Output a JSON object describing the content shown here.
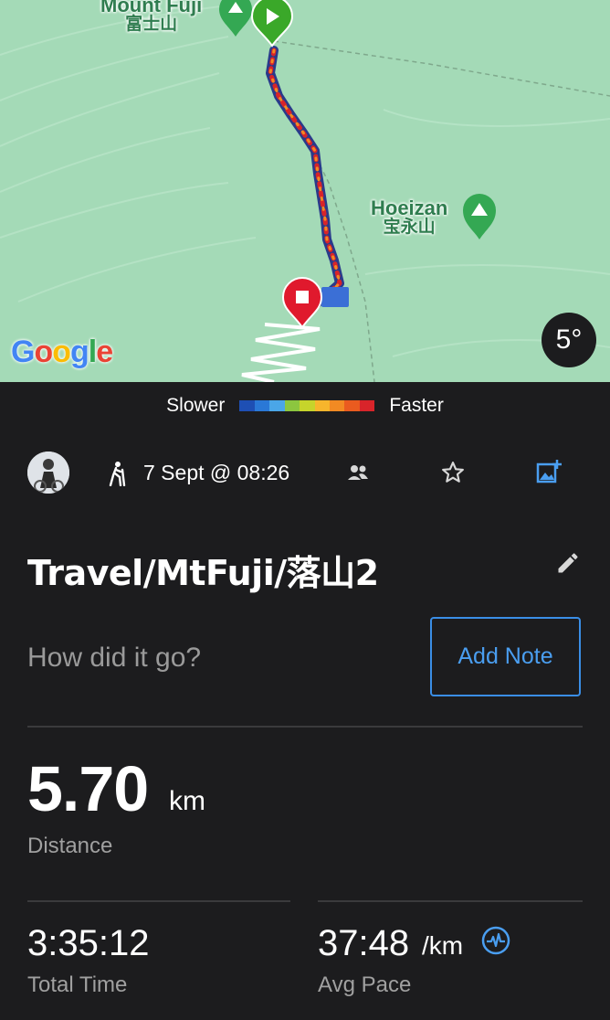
{
  "map": {
    "labels": {
      "fuji_en": "Mount Fuji",
      "fuji_jp": "富士山",
      "hoeizan_en": "Hoeizan",
      "hoeizan_jp": "宝永山"
    },
    "google_logo": "Google",
    "temperature": "5°",
    "start_marker_icon": "play-icon",
    "end_marker_icon": "stop-icon",
    "colors": {
      "land": "#a4dab7",
      "start_marker": "#3aa829",
      "end_marker": "#e0192d"
    }
  },
  "legend": {
    "slower": "Slower",
    "faster": "Faster",
    "colors": [
      "#1e4fb4",
      "#2a78d6",
      "#4aa6e8",
      "#8cc63f",
      "#c6d42b",
      "#f7b52c",
      "#f28a23",
      "#ea5b1f",
      "#d8242a"
    ]
  },
  "activity": {
    "type_icon": "hiking-icon",
    "date": "7 Sept @ 08:26",
    "title": "Travel/MtFuji/落山2",
    "note_placeholder": "How did it go?",
    "add_note_label": "Add Note"
  },
  "stats": {
    "distance": {
      "value": "5.70",
      "unit": "km",
      "label": "Distance"
    },
    "total_time": {
      "value": "3:35:12",
      "label": "Total Time"
    },
    "avg_pace": {
      "value": "37:48",
      "unit": "/km",
      "label": "Avg Pace"
    }
  },
  "theme": {
    "accent": "#3a8ee6",
    "background": "#1c1c1e"
  }
}
